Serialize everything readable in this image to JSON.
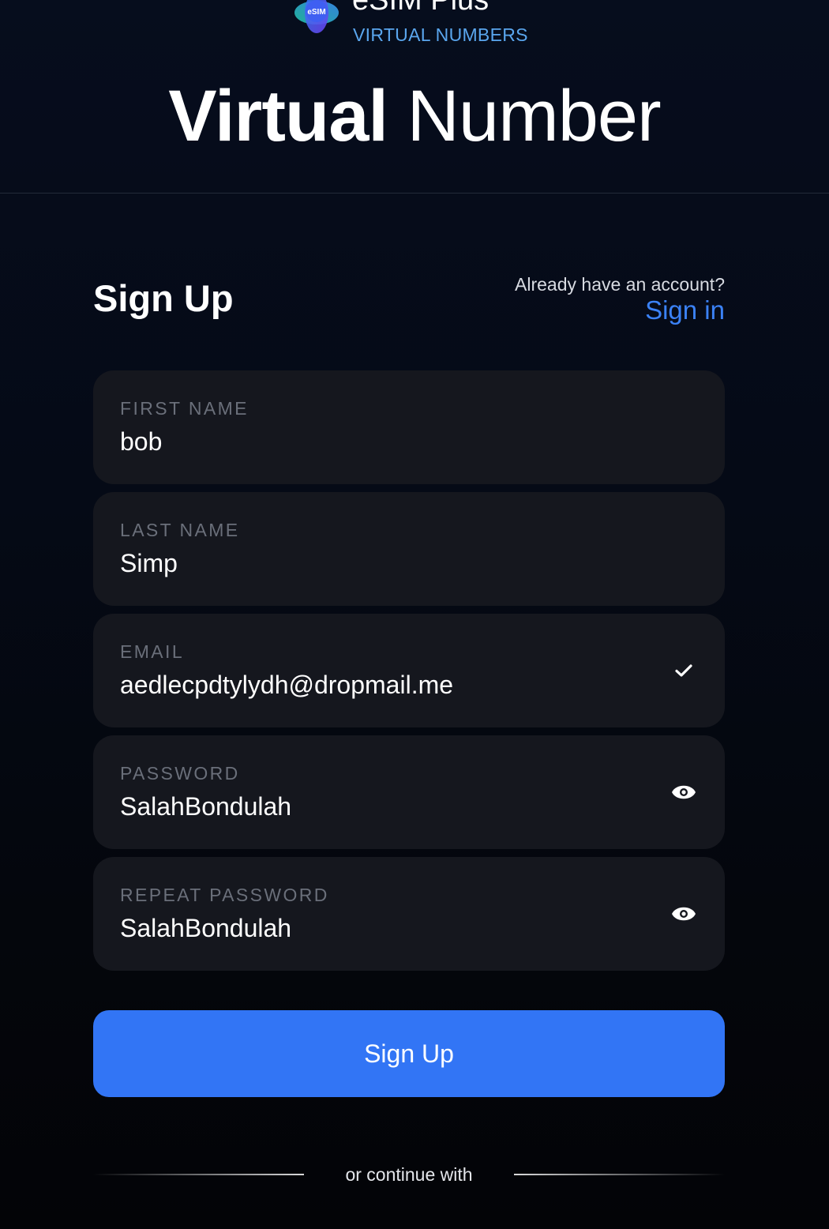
{
  "brand": {
    "name": "eSIM Plus",
    "logo_text": "eSIM",
    "subtitle": "VIRTUAL NUMBERS"
  },
  "hero": {
    "title_bold": "Virtual",
    "title_light": "Number"
  },
  "form": {
    "heading": "Sign Up",
    "account_question": "Already have an account?",
    "signin_label": "Sign in",
    "fields": [
      {
        "label": "FIRST NAME",
        "value": "bob"
      },
      {
        "label": "LAST NAME",
        "value": "Simp"
      },
      {
        "label": "EMAIL",
        "value": "aedlecpdtylydh@dropmail.me",
        "icon": "checkmark-icon"
      },
      {
        "label": "PASSWORD",
        "value": "SalahBondulah",
        "icon": "eye-icon"
      },
      {
        "label": "REPEAT PASSWORD",
        "value": "SalahBondulah",
        "icon": "eye-icon"
      }
    ],
    "submit_label": "Sign Up",
    "divider_text": "or continue with"
  },
  "colors": {
    "accent": "#3275f5",
    "link": "#3b82f6",
    "subtitle": "#5aa6ee",
    "field_bg": "#15171e",
    "label": "#6a6f7a"
  }
}
